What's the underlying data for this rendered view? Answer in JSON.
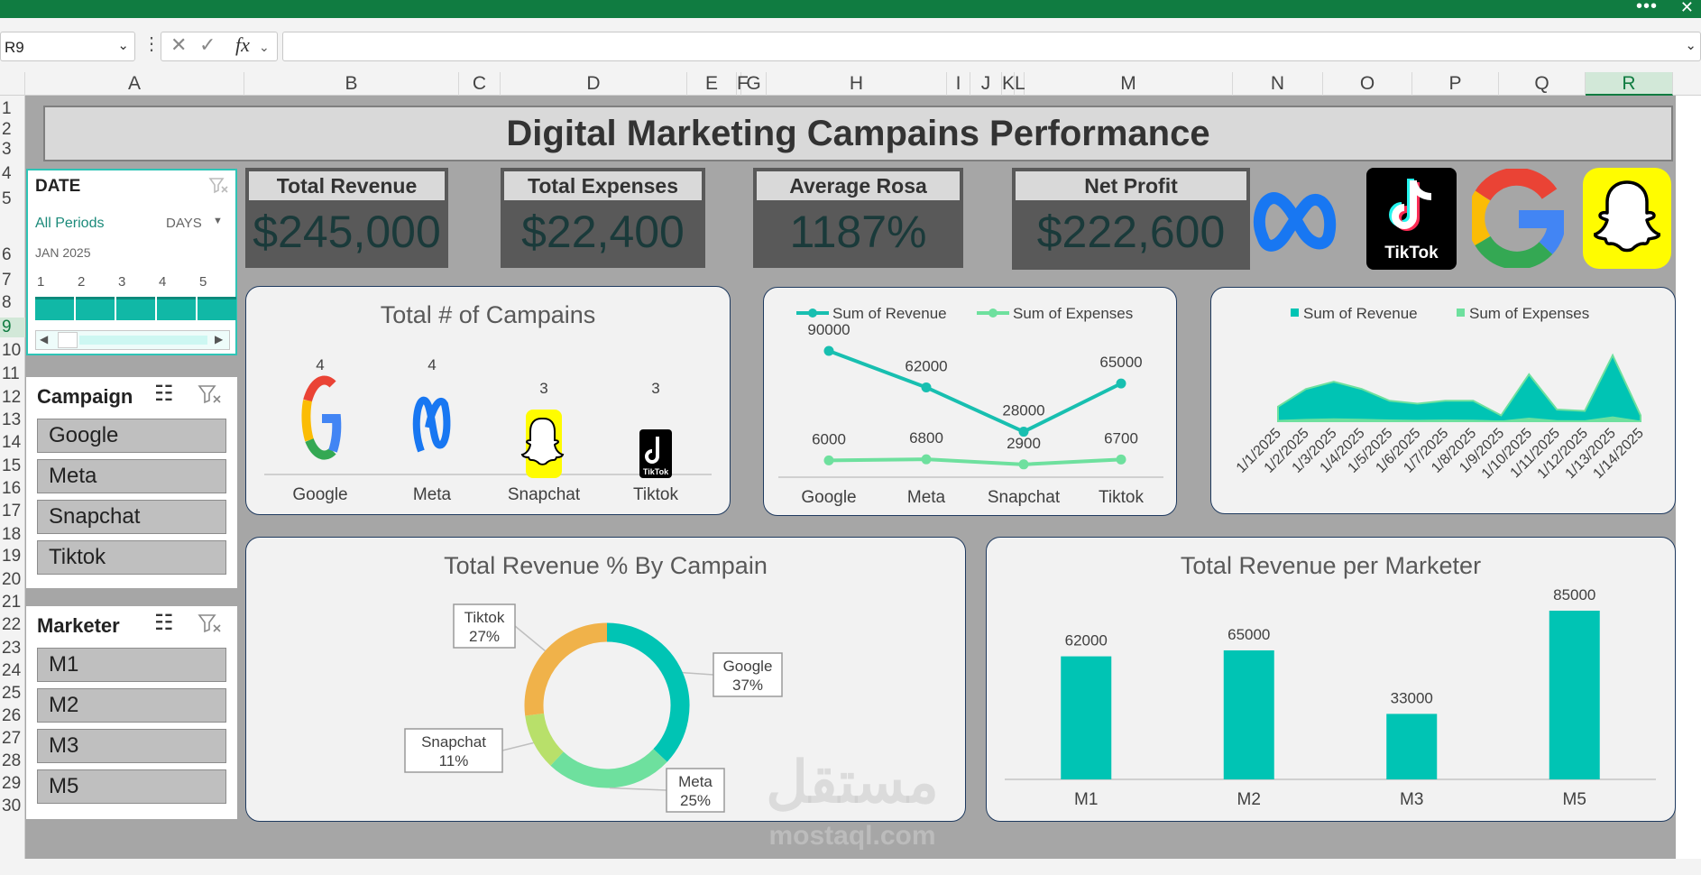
{
  "formula_bar": {
    "name_box": "R9",
    "fx": "fx"
  },
  "columns": [
    "A",
    "B",
    "C",
    "D",
    "E",
    "F",
    "G",
    "H",
    "I",
    "J",
    "K",
    "L",
    "M",
    "N",
    "O",
    "P",
    "Q",
    "R"
  ],
  "rows": [
    "1",
    "2",
    "3",
    "4",
    "5",
    "6",
    "7",
    "8",
    "9",
    "10",
    "11",
    "12",
    "13",
    "14",
    "15",
    "16",
    "17",
    "18",
    "19",
    "20",
    "21",
    "22",
    "23",
    "24",
    "25",
    "26",
    "27",
    "28",
    "29",
    "30"
  ],
  "title": "Digital Marketing Campains Performance",
  "date_slicer": {
    "header": "DATE",
    "period": "All Periods",
    "unit": "DAYS",
    "month": "JAN 2025",
    "days": [
      "1",
      "2",
      "3",
      "4",
      "5"
    ]
  },
  "campaign_slicer": {
    "header": "Campaign",
    "items": [
      "Google",
      "Meta",
      "Snapchat",
      "Tiktok"
    ]
  },
  "marketer_slicer": {
    "header": "Marketer",
    "items": [
      "M1",
      "M2",
      "M3",
      "M5"
    ]
  },
  "kpis": [
    {
      "label": "Total Revenue",
      "value": "$245,000"
    },
    {
      "label": "Total Expenses",
      "value": "$22,400"
    },
    {
      "label": "Average Rosa",
      "value": "1187%"
    },
    {
      "label": "Net Profit",
      "value": "$222,600"
    }
  ],
  "logos": [
    "meta-logo",
    "tiktok-logo",
    "google-logo",
    "snapchat-logo"
  ],
  "tiktok_text": "TikTok",
  "colors": {
    "teal": "#00c4b4",
    "green": "#6ee09e",
    "orange": "#f0b24a",
    "lime": "#b8e06a",
    "bg": "#a6a6a6"
  },
  "chart_data": [
    {
      "type": "bar",
      "title": "Total # of Campains",
      "categories": [
        "Google",
        "Meta",
        "Snapchat",
        "Tiktok"
      ],
      "values": [
        4,
        4,
        3,
        3
      ]
    },
    {
      "type": "line",
      "title": "",
      "categories": [
        "Google",
        "Meta",
        "Snapchat",
        "Tiktok"
      ],
      "legend": "top",
      "series": [
        {
          "name": "Sum of Revenue",
          "values": [
            90000,
            62000,
            28000,
            65000
          ],
          "color": "#18bfb0"
        },
        {
          "name": "Sum of Expenses",
          "values": [
            6000,
            6800,
            2900,
            6700
          ],
          "color": "#6ee09e"
        }
      ]
    },
    {
      "type": "area",
      "title": "",
      "categories": [
        "1/1/2025",
        "1/2/2025",
        "1/3/2025",
        "1/4/2025",
        "1/5/2025",
        "1/6/2025",
        "1/7/2025",
        "1/8/2025",
        "1/9/2025",
        "1/10/2025",
        "1/11/2025",
        "1/12/2025",
        "1/13/2025",
        "1/14/2025"
      ],
      "legend": "top",
      "series": [
        {
          "name": "Sum of Revenue",
          "values": [
            10000,
            22000,
            27000,
            22000,
            14000,
            12000,
            14000,
            14000,
            4000,
            32000,
            8000,
            7000,
            45000,
            4000
          ],
          "color": "#00c4b4"
        },
        {
          "name": "Sum of Expenses",
          "values": [
            900,
            1600,
            2000,
            1700,
            1200,
            1000,
            1200,
            1100,
            500,
            2500,
            800,
            700,
            3300,
            400
          ],
          "color": "#6ee09e"
        }
      ]
    },
    {
      "type": "pie",
      "title": "Total Revenue % By Campain",
      "categories": [
        "Google",
        "Meta",
        "Snapchat",
        "Tiktok"
      ],
      "values": [
        37,
        25,
        11,
        27
      ],
      "labels": [
        {
          "name": "Google",
          "pct": "37%"
        },
        {
          "name": "Meta",
          "pct": "25%"
        },
        {
          "name": "Snapchat",
          "pct": "11%"
        },
        {
          "name": "Tiktok",
          "pct": "27%"
        }
      ],
      "colors": [
        "#00c4b4",
        "#6ee09e",
        "#b8e06a",
        "#f0b24a"
      ]
    },
    {
      "type": "bar",
      "title": "Total Revenue per Marketer",
      "categories": [
        "M1",
        "M2",
        "M3",
        "M5"
      ],
      "values": [
        62000,
        65000,
        33000,
        85000
      ],
      "ylim": [
        0,
        90000
      ]
    }
  ],
  "watermark": {
    "arabic": "مستقل",
    "latin": "mostaql.com"
  }
}
